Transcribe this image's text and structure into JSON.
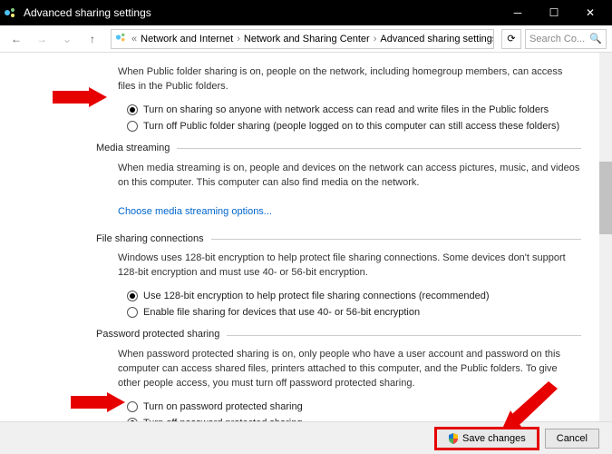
{
  "window_title": "Advanced sharing settings",
  "breadcrumb": {
    "items": [
      "Network and Internet",
      "Network and Sharing Center",
      "Advanced sharing settings"
    ]
  },
  "search_placeholder": "Search Co...",
  "public_folder": {
    "desc": "When Public folder sharing is on, people on the network, including homegroup members, can access files in the Public folders.",
    "opt_on": "Turn on sharing so anyone with network access can read and write files in the Public folders",
    "opt_off": "Turn off Public folder sharing (people logged on to this computer can still access these folders)"
  },
  "media": {
    "title": "Media streaming",
    "desc": "When media streaming is on, people and devices on the network can access pictures, music, and videos on this computer. This computer can also find media on the network.",
    "link": "Choose media streaming options..."
  },
  "filesharing": {
    "title": "File sharing connections",
    "desc": "Windows uses 128-bit encryption to help protect file sharing connections. Some devices don't support 128-bit encryption and must use 40- or 56-bit encryption.",
    "opt_128": "Use 128-bit encryption to help protect file sharing connections (recommended)",
    "opt_40": "Enable file sharing for devices that use 40- or 56-bit encryption"
  },
  "password": {
    "title": "Password protected sharing",
    "desc": "When password protected sharing is on, only people who have a user account and password on this computer can access shared files, printers attached to this computer, and the Public folders. To give other people access, you must turn off password protected sharing.",
    "opt_on": "Turn on password protected sharing",
    "opt_off": "Turn off password protected sharing"
  },
  "buttons": {
    "save": "Save changes",
    "cancel": "Cancel"
  }
}
